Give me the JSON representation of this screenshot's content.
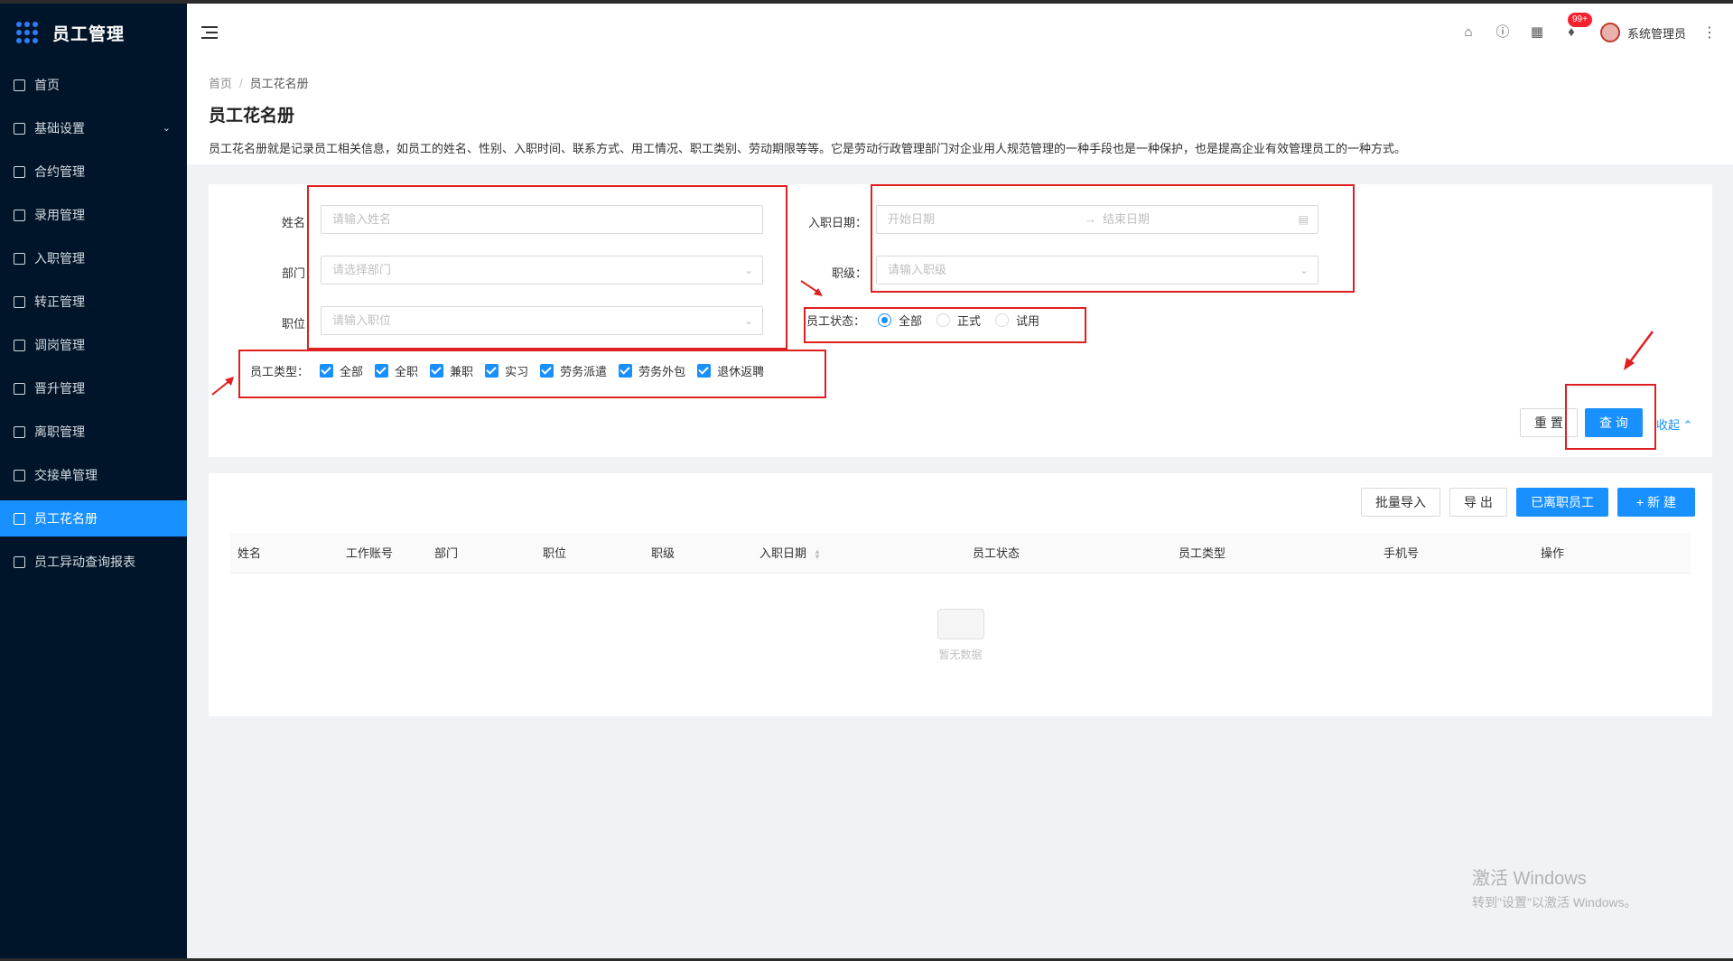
{
  "app": {
    "title": "员工管理"
  },
  "sidebar": {
    "items": [
      {
        "label": "首页",
        "icon": "home-icon"
      },
      {
        "label": "基础设置",
        "icon": "mail-icon",
        "has_children": true
      },
      {
        "label": "合约管理",
        "icon": "calendar-icon"
      },
      {
        "label": "录用管理",
        "icon": "form-icon"
      },
      {
        "label": "入职管理",
        "icon": "file-icon"
      },
      {
        "label": "转正管理",
        "icon": "grid-icon"
      },
      {
        "label": "调岗管理",
        "icon": "user-icon"
      },
      {
        "label": "晋升管理",
        "icon": "document-icon"
      },
      {
        "label": "离职管理",
        "icon": "user-remove-icon"
      },
      {
        "label": "交接单管理",
        "icon": "copy-icon"
      },
      {
        "label": "员工花名册",
        "icon": "roster-icon",
        "active": true
      },
      {
        "label": "员工异动查询报表",
        "icon": "report-icon"
      }
    ]
  },
  "header": {
    "notification_count": "99+",
    "username": "系统管理员"
  },
  "breadcrumb": {
    "home": "首页",
    "current": "员工花名册"
  },
  "page": {
    "title": "员工花名册",
    "description": "员工花名册就是记录员工相关信息，如员工的姓名、性别、入职时间、联系方式、用工情况、职工类别、劳动期限等等。它是劳动行政管理部门对企业用人规范管理的一种手段也是一种保护，也是提高企业有效管理员工的一种方式。"
  },
  "search": {
    "name_label": "姓名：",
    "name_placeholder": "请输入姓名",
    "dept_label": "部门：",
    "dept_placeholder": "请选择部门",
    "position_label": "职位：",
    "position_placeholder": "请输入职位",
    "entry_date_label": "入职日期：",
    "start_placeholder": "开始日期",
    "end_placeholder": "结束日期",
    "level_label": "职级：",
    "level_placeholder": "请输入职级",
    "status_label": "员工状态：",
    "status_options": [
      "全部",
      "正式",
      "试用"
    ],
    "status_selected": "全部",
    "type_label": "员工类型：",
    "type_options": [
      "全部",
      "全职",
      "兼职",
      "实习",
      "劳务派遣",
      "劳务外包",
      "退休返聘"
    ],
    "reset_label": "重 置",
    "query_label": "查 询",
    "collapse_label": "收起"
  },
  "table": {
    "buttons": {
      "import": "批量导入",
      "export": "导 出",
      "resigned": "已离职员工",
      "add": "新 建"
    },
    "columns": [
      "姓名",
      "工作账号",
      "部门",
      "职位",
      "职级",
      "入职日期",
      "员工状态",
      "员工类型",
      "手机号",
      "操作"
    ],
    "rows": [],
    "empty_text": "暂无数据"
  },
  "watermark": {
    "line1": "激活 Windows",
    "line2": "转到\"设置\"以激活 Windows。"
  },
  "colors": {
    "sidebar_bg": "#001529",
    "primary": "#1890ff",
    "annotation_red": "#e02020"
  }
}
